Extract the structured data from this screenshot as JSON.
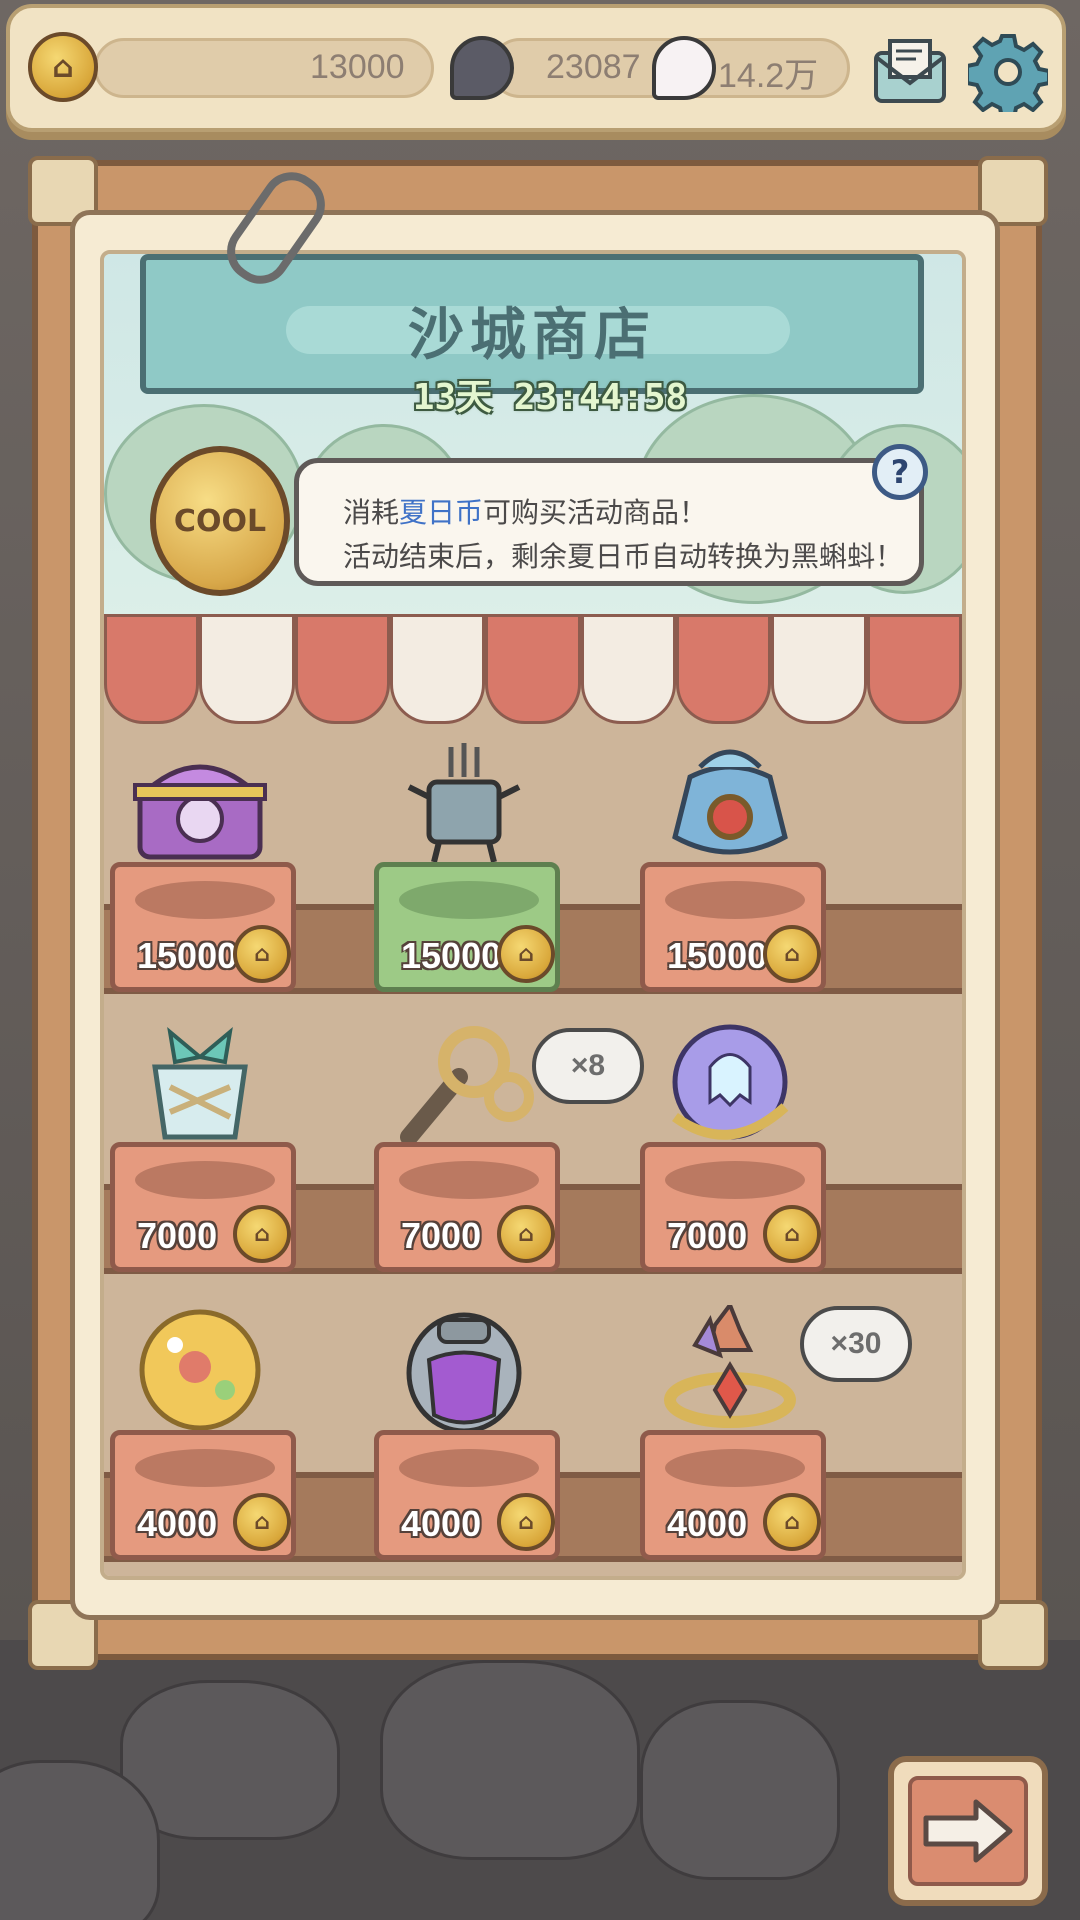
{
  "resources": {
    "coin": {
      "value": "13000",
      "icon": "summer-coin-icon"
    },
    "dark_ghost": {
      "value": "23087",
      "icon": "dark-ghost-icon"
    },
    "light_ghost": {
      "value": "14.2万",
      "icon": "light-ghost-icon"
    }
  },
  "top_buttons": {
    "mail": "mail-icon",
    "settings": "gear-icon"
  },
  "shop": {
    "title": "沙城商店",
    "timer": "13天 23:44:58",
    "info_line1_pre": "消耗",
    "info_line1_hl": "夏日币",
    "info_line1_post": "可购买活动商品！",
    "info_line2": "活动结束后，剩余夏日币自动转换为黑蝌蚪！",
    "help_label": "?",
    "coin_label": "COOL"
  },
  "items": [
    {
      "name": "purple-chest",
      "price": "15000",
      "qty": "",
      "tag": "red"
    },
    {
      "name": "incense-burner",
      "price": "15000",
      "qty": "",
      "tag": "green"
    },
    {
      "name": "treasure-pouch",
      "price": "15000",
      "qty": "",
      "tag": "red"
    },
    {
      "name": "ribbon-jar",
      "price": "7000",
      "qty": "",
      "tag": "red"
    },
    {
      "name": "cloud-horn",
      "price": "7000",
      "qty": "×8",
      "tag": "red"
    },
    {
      "name": "ghost-orb",
      "price": "7000",
      "qty": "",
      "tag": "red"
    },
    {
      "name": "golden-ball",
      "price": "4000",
      "qty": "",
      "tag": "red"
    },
    {
      "name": "mecha-egg",
      "price": "4000",
      "qty": "",
      "tag": "red"
    },
    {
      "name": "crystal-crown",
      "price": "4000",
      "qty": "×30",
      "tag": "red"
    }
  ],
  "colors": {
    "highlight": "#3f72c7",
    "tag_red": "#e59a7f",
    "tag_green": "#9dca86"
  },
  "next_button": {
    "icon": "arrow-right-icon"
  }
}
